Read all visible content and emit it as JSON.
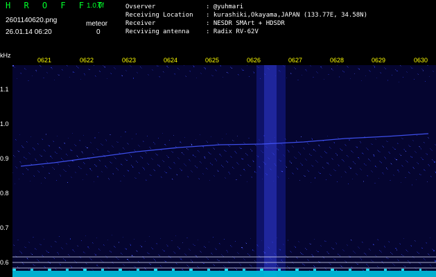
{
  "app": {
    "title": "H R O F F T",
    "version": "1.0.0f"
  },
  "file": {
    "name": "2601140620.png",
    "datetime": "26.01.14 06:20"
  },
  "meteor": {
    "label": "meteor",
    "count": "0"
  },
  "metadata": {
    "observer_label": "Ovserver",
    "observer_value": ": @yuhmari",
    "location_label": "Receiving Location",
    "location_value": ": kurashiki,Okayama,JAPAN (133.77E, 34.58N)",
    "receiver_label": "Receiver",
    "receiver_value": ": NESDR SMArt + HDSDR",
    "antenna_label": "Recviving antenna",
    "antenna_value": ": Radix RV-62V"
  },
  "axis": {
    "y_unit": "kHz",
    "y_ticks": [
      "1.1",
      "1.0",
      "0.9",
      "0.8",
      "0.7",
      "0.6"
    ],
    "x_ticks": [
      "0621",
      "0622",
      "0623",
      "0624",
      "0625",
      "0626",
      "0627",
      "0628",
      "0629",
      "0630"
    ]
  },
  "colors": {
    "background": "#000000",
    "title_green": "#00ff2a",
    "time_yellow": "#ffff00",
    "signal_blue": "#3a4dff",
    "baseline_cyan": "#00e5ff"
  }
}
